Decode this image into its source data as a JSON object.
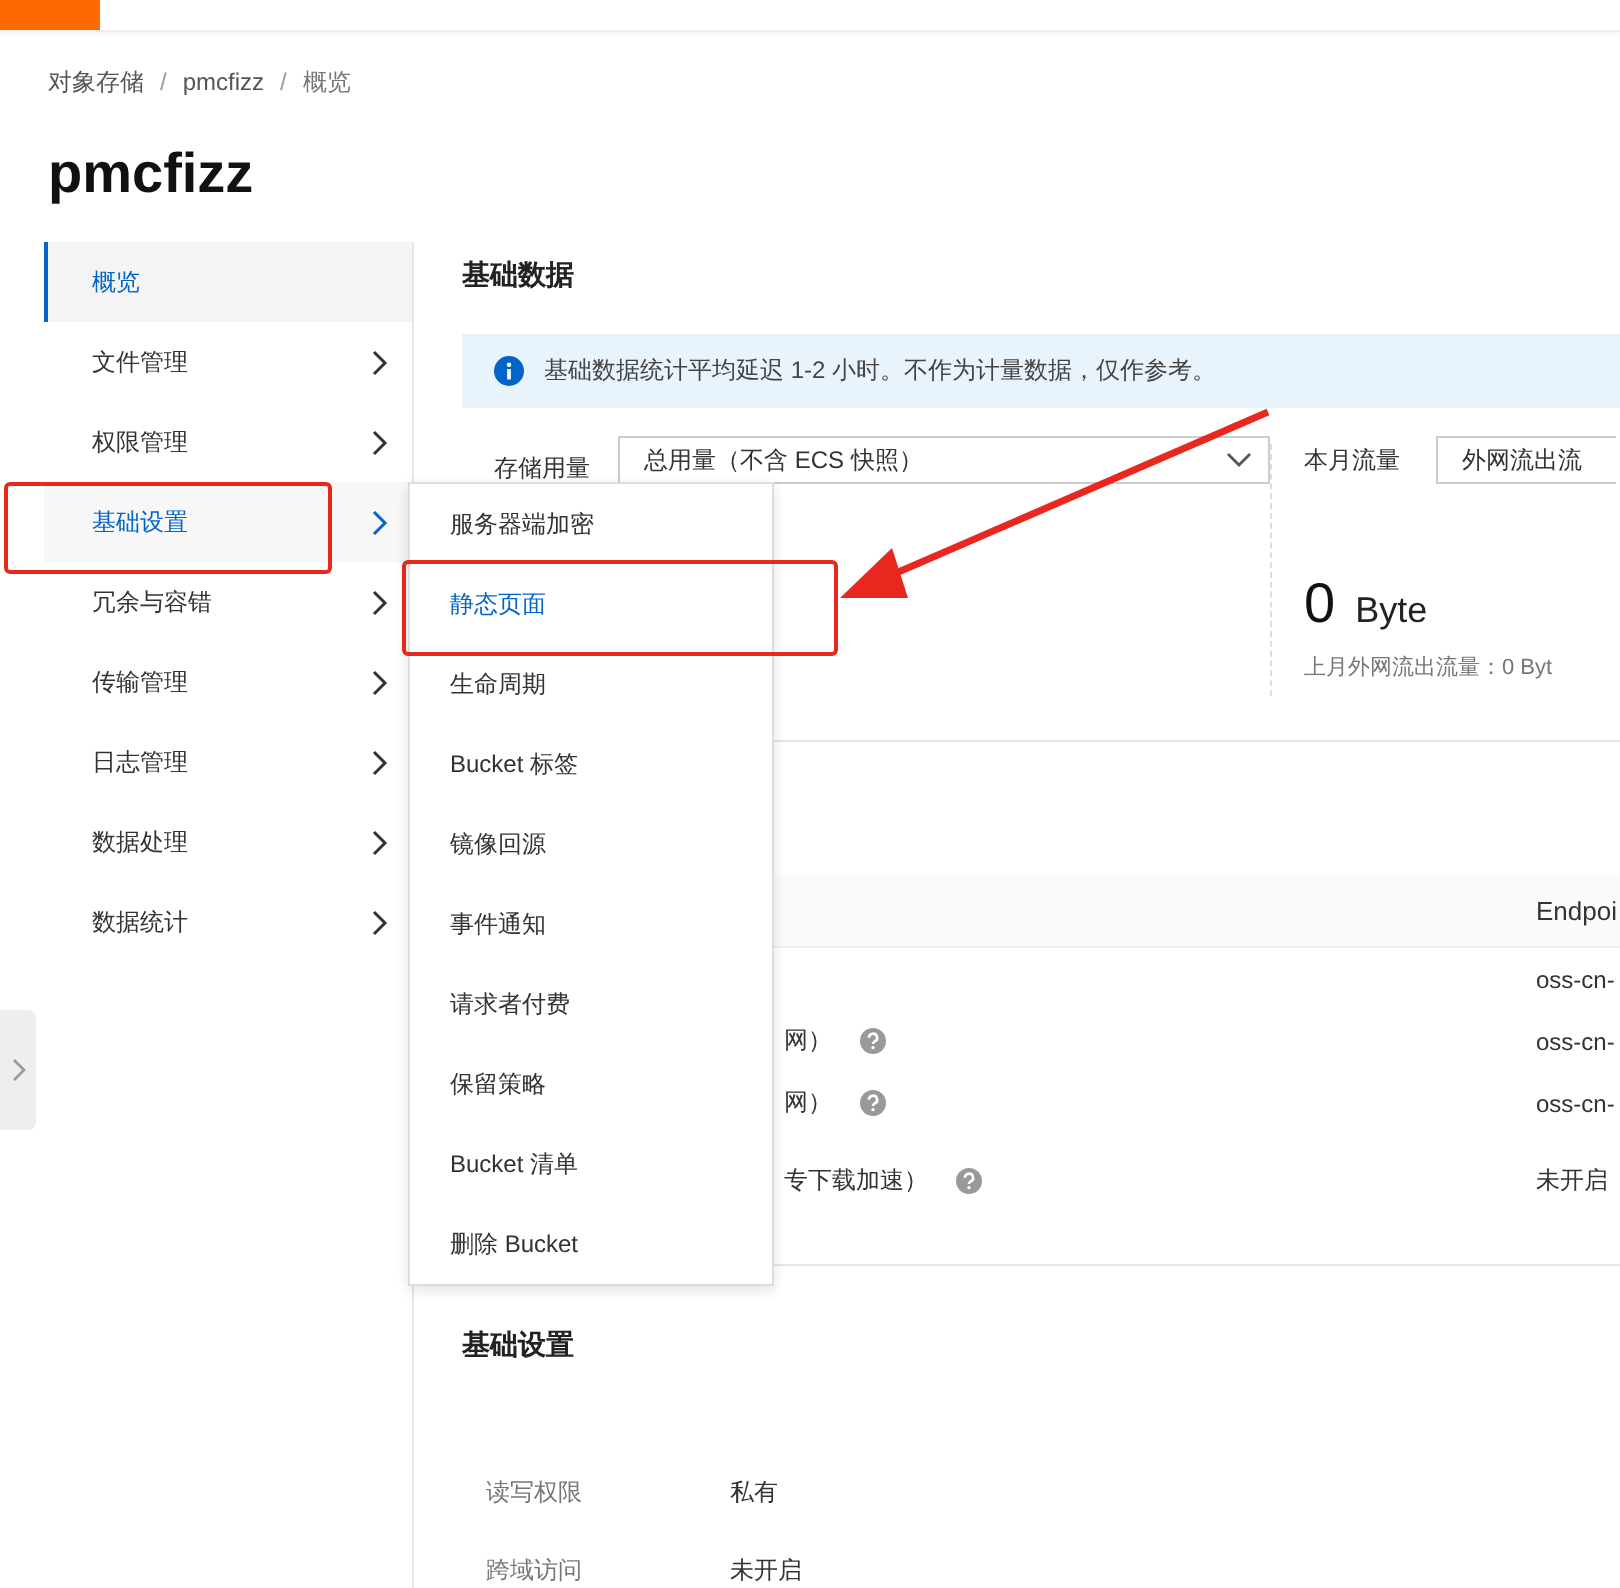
{
  "breadcrumb": {
    "separator": "/",
    "items": [
      "对象存储",
      "pmcfizz",
      "概览"
    ]
  },
  "title": "pmcfizz",
  "sidebar": {
    "items": [
      {
        "label": "概览",
        "selected": true,
        "open": false,
        "submenu": false
      },
      {
        "label": "文件管理",
        "selected": false,
        "open": false,
        "submenu": true
      },
      {
        "label": "权限管理",
        "selected": false,
        "open": false,
        "submenu": true
      },
      {
        "label": "基础设置",
        "selected": false,
        "open": true,
        "submenu": true
      },
      {
        "label": "冗余与容错",
        "selected": false,
        "open": false,
        "submenu": true
      },
      {
        "label": "传输管理",
        "selected": false,
        "open": false,
        "submenu": true
      },
      {
        "label": "日志管理",
        "selected": false,
        "open": false,
        "submenu": true
      },
      {
        "label": "数据处理",
        "selected": false,
        "open": false,
        "submenu": true
      },
      {
        "label": "数据统计",
        "selected": false,
        "open": false,
        "submenu": true
      }
    ]
  },
  "flyout_menu": {
    "items": [
      {
        "label": "服务器端加密",
        "selected": false
      },
      {
        "label": "静态页面",
        "selected": true
      },
      {
        "label": "生命周期",
        "selected": false
      },
      {
        "label": "Bucket 标签",
        "selected": false
      },
      {
        "label": "镜像回源",
        "selected": false
      },
      {
        "label": "事件通知",
        "selected": false
      },
      {
        "label": "请求者付费",
        "selected": false
      },
      {
        "label": "保留策略",
        "selected": false
      },
      {
        "label": "Bucket 清单",
        "selected": false
      },
      {
        "label": "删除 Bucket",
        "selected": false
      }
    ]
  },
  "basic_data": {
    "title": "基础数据",
    "notice": "基础数据统计平均延迟 1-2 小时。不作为计量数据，仅作参考。",
    "storage": {
      "label": "存储用量",
      "select": "总用量（不含 ECS 快照）"
    },
    "traffic": {
      "label": "本月流量",
      "select": "外网流出流",
      "value": "0",
      "unit": "Byte",
      "note": "上月外网流出流量：0 Byt"
    }
  },
  "access_table": {
    "columns": [
      "Endpoi"
    ],
    "rows": [
      {
        "help": false,
        "value": "oss-cn-"
      },
      {
        "label": "网）",
        "help": true,
        "value": "oss-cn-"
      },
      {
        "label": "网）",
        "help": true,
        "value": "oss-cn-"
      },
      {
        "label": "专下载加速）",
        "help": true,
        "value": "未开启"
      }
    ]
  },
  "settings": {
    "title": "基础设置",
    "rows": [
      {
        "label": "读写权限",
        "value": "私有"
      },
      {
        "label": "跨域访问",
        "value": "未开启"
      }
    ]
  }
}
